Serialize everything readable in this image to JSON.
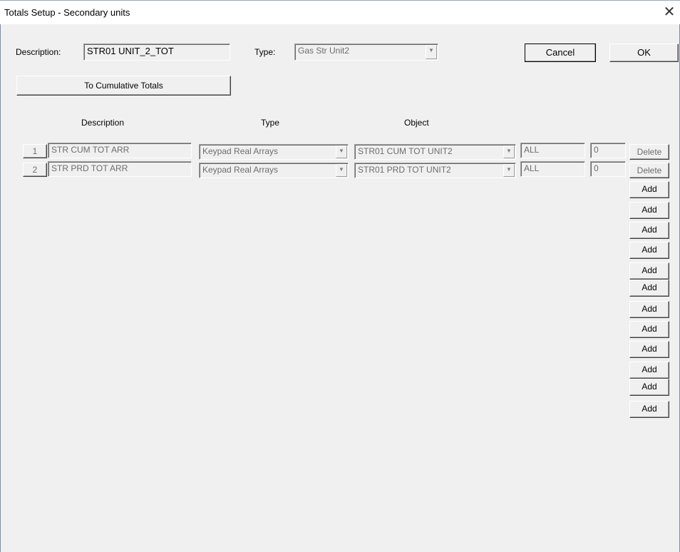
{
  "window": {
    "title": "Totals Setup - Secondary units",
    "close_glyph": "✕"
  },
  "header": {
    "description_label": "Description:",
    "description_value": "STR01 UNIT_2_TOT",
    "type_label": "Type:",
    "type_value": "Gas Str Unit2",
    "cancel_label": "Cancel",
    "ok_label": "OK",
    "cumulative_button": "To Cumulative Totals"
  },
  "columns": {
    "description": "Description",
    "type": "Type",
    "object": "Object"
  },
  "rows": [
    {
      "num": "1",
      "description": "STR CUM TOT ARR",
      "type": "Keypad Real Arrays",
      "object": "STR01 CUM TOT UNIT2",
      "range": "ALL",
      "index": "0",
      "delete": "Delete"
    },
    {
      "num": "2",
      "description": "STR PRD TOT ARR",
      "type": "Keypad Real Arrays",
      "object": "STR01 PRD TOT UNIT2",
      "range": "ALL",
      "index": "0",
      "delete": "Delete"
    }
  ],
  "add_buttons": [
    "Add",
    "Add",
    "Add",
    "Add",
    "Add",
    "Add",
    "Add",
    "Add",
    "Add",
    "Add",
    "Add",
    "Add"
  ]
}
